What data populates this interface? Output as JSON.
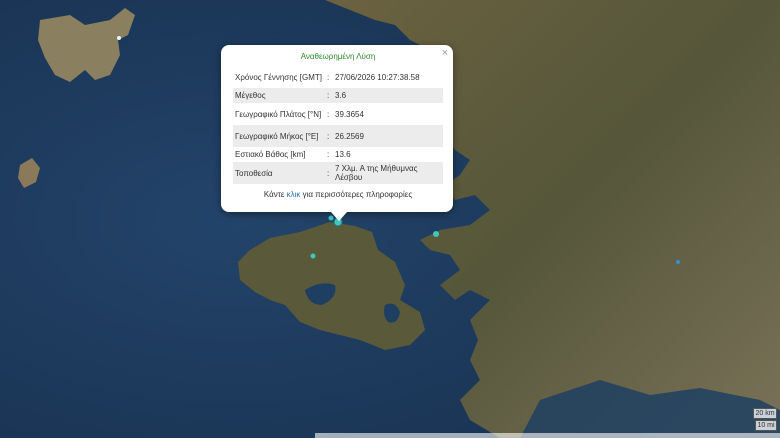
{
  "popup": {
    "title": "Αναθεωρημένη Λύση",
    "close": "×",
    "rows": [
      {
        "label": "Χρόνος Γέννησης [GMT]",
        "value": "27/06/2026 10:27:38.58"
      },
      {
        "label": "Μέγεθος",
        "value": "3.6"
      },
      {
        "label": "Γεωγραφικό Πλάτος [°N]",
        "value": "39.3654"
      },
      {
        "label": "Γεωγραφικό Μήκος [°E]",
        "value": "26.2569"
      },
      {
        "label": "Εστιακό Βάθος [km]",
        "value": "13.6"
      },
      {
        "label": "Τοποθεσία",
        "value": "7 Χλμ. Α της Μήθυμνας Λέσβου"
      }
    ],
    "more_prefix": "Κάντε ",
    "more_link": "κλικ",
    "more_suffix": " για περισσότερες πληροφορίες"
  },
  "scale": {
    "km": "20 km",
    "mi": "10 mi"
  },
  "colors": {
    "sea": "#1d3a5c",
    "land": "#5d5a3a",
    "marker": "#3fc7c0"
  }
}
